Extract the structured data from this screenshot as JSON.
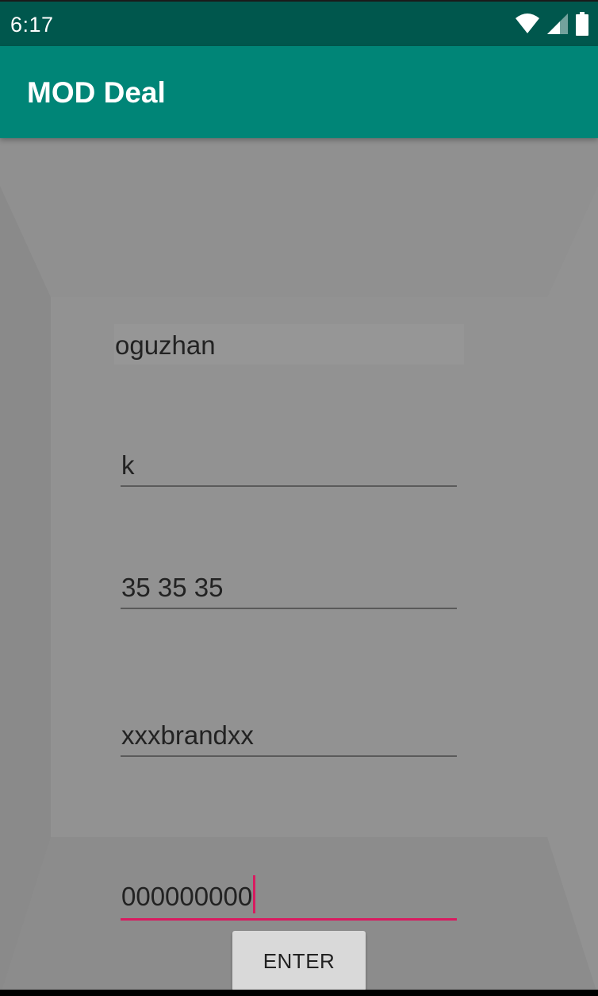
{
  "status_bar": {
    "time": "6:17",
    "icons": [
      "wifi-icon",
      "signal-icon",
      "battery-icon"
    ]
  },
  "app_bar": {
    "title": "MOD Deal",
    "color": "#008577"
  },
  "form": {
    "name_value": "oguzhan",
    "field2_value": "k",
    "field3_value": "35 35 35",
    "field4_value": "xxxbrandxx",
    "field5_value": "000000000"
  },
  "enter_button": {
    "label": "ENTER"
  },
  "colors": {
    "status_bar": "#00574d",
    "accent": "#d81b60",
    "background": "#8f8f8f"
  }
}
